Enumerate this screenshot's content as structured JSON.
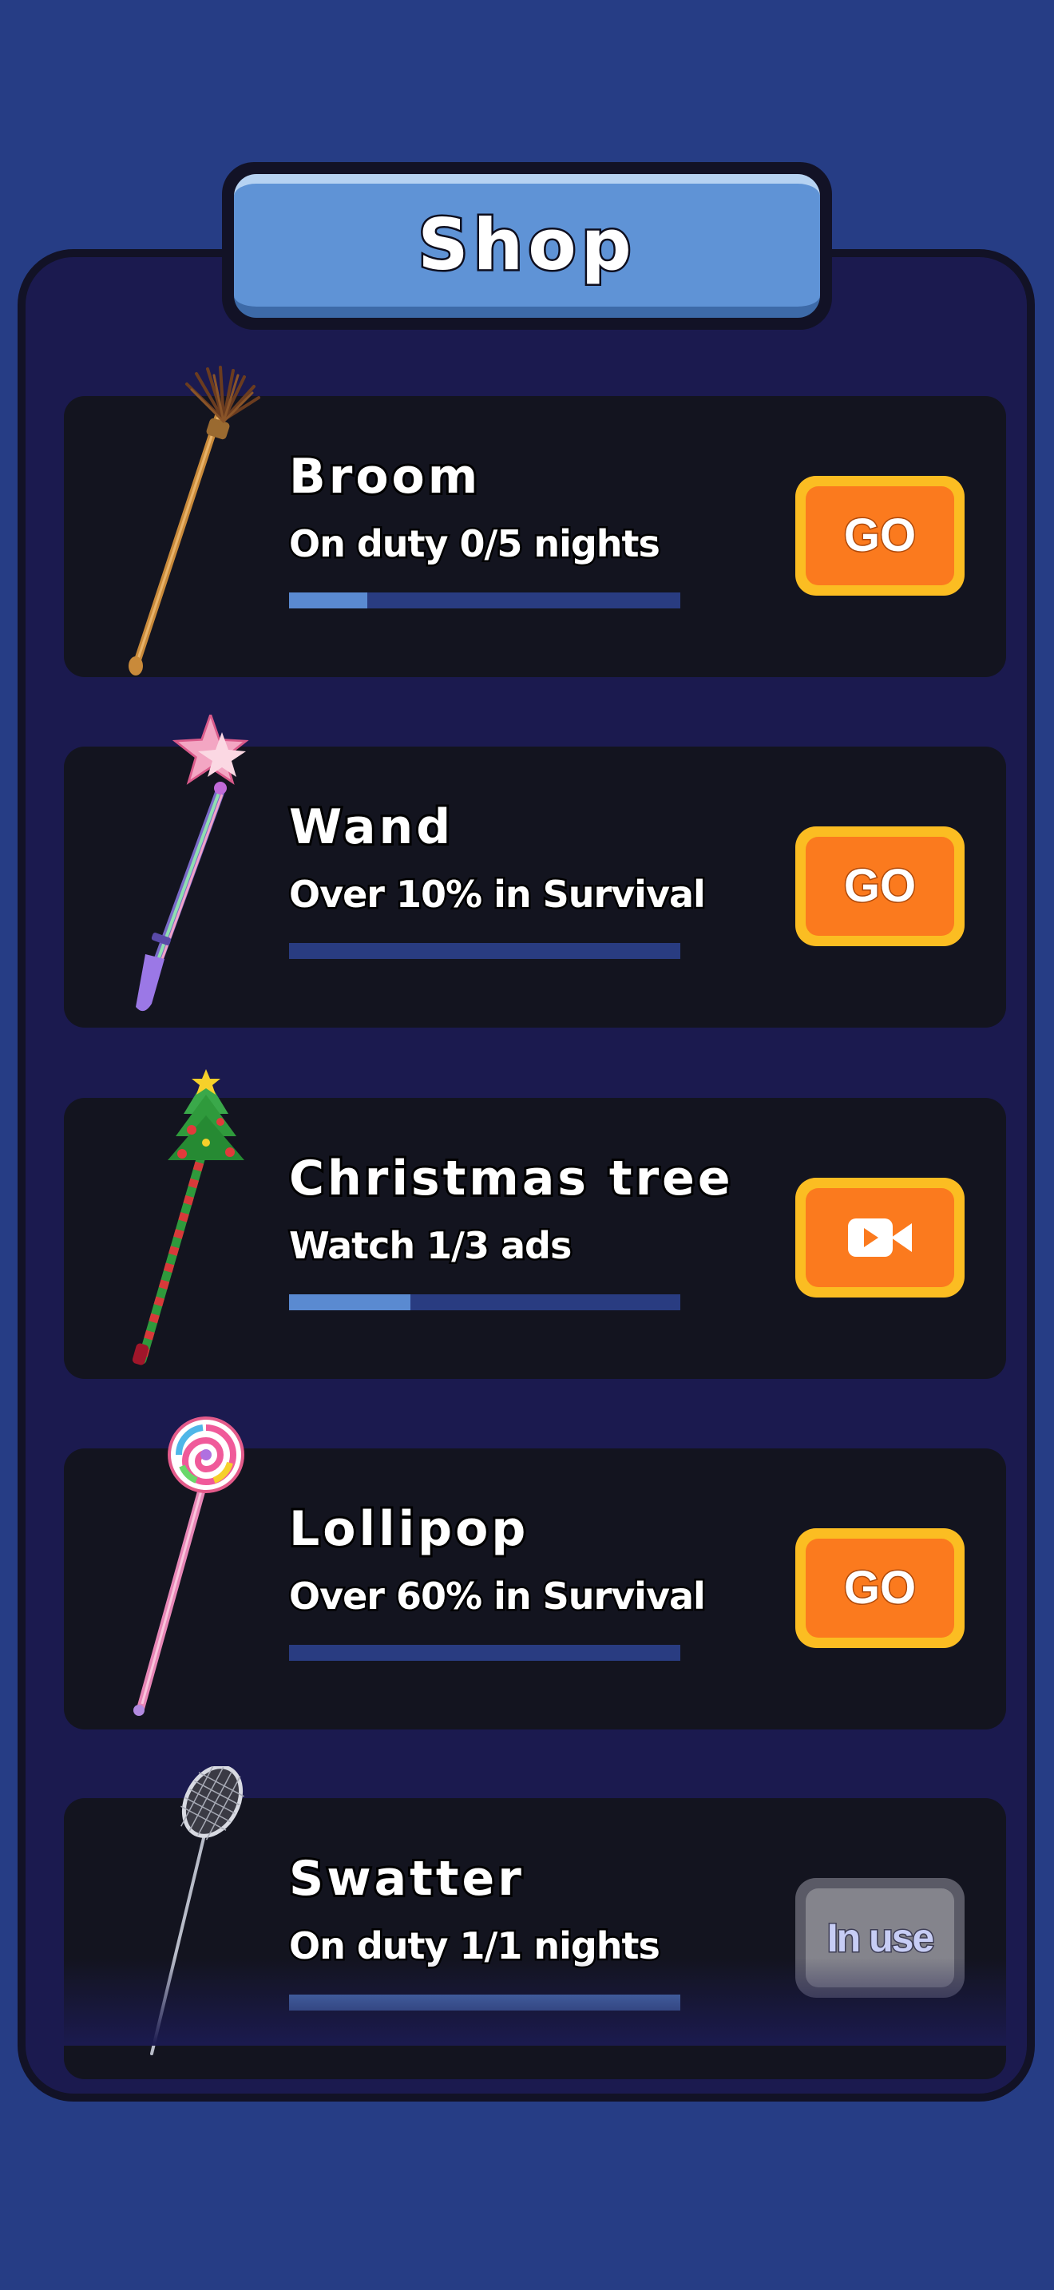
{
  "title": "Shop",
  "items": [
    {
      "name": "Broom",
      "task": "On duty 0/5 nights",
      "progress": 0.2,
      "button": {
        "type": "text",
        "label": "GO"
      }
    },
    {
      "name": "Wand",
      "task": "Over 10% in Survival",
      "progress": 0,
      "button": {
        "type": "text",
        "label": "GO"
      }
    },
    {
      "name": "Christmas tree",
      "task": "Watch 1/3 ads",
      "progress": 0.31,
      "button": {
        "type": "icon",
        "icon": "video-icon"
      }
    },
    {
      "name": "Lollipop",
      "task": "Over 60% in Survival",
      "progress": 0,
      "button": {
        "type": "text",
        "label": "GO"
      }
    },
    {
      "name": "Swatter",
      "task": "On duty 1/1 nights",
      "progress": 1,
      "button": {
        "type": "text",
        "label": "In use"
      }
    }
  ],
  "colors": {
    "background": "#263d85",
    "panel": "#1b1a4f",
    "card": "#13141f",
    "progress_track": "#293c81",
    "progress_fill": "#5a8ad1",
    "button_border": "#fbbd22",
    "button_fill": "#fb7a1e",
    "title_fill": "#5f93d6"
  }
}
